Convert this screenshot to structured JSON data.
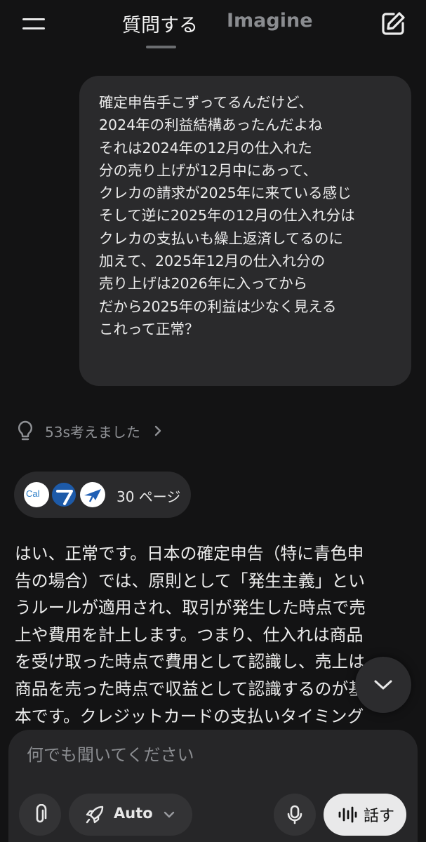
{
  "header": {
    "tabs": [
      {
        "label": "質問する",
        "active": true
      },
      {
        "label": "Imagine",
        "active": false
      }
    ],
    "icons": {
      "menu": "hamburger-menu-icon",
      "new_chat": "edit-square-icon"
    }
  },
  "conversation": {
    "user_message": {
      "lines": [
        "確定申告手こずってるんだけど、",
        "2024年の利益結構あったんだよね",
        "それは2024年の12月の仕入れた",
        "分の売り上げが12月中にあって、",
        "クレカの請求が2025年に来ている感じ",
        "そして逆に2025年の12月の仕入れ分は",
        "クレカの支払いも繰上返済してるのに",
        "加えて、2025年12月の仕入れ分の",
        "売り上げは2026年に入ってから",
        "だから2025年の利益は少なく見える",
        "これって正常？"
      ]
    },
    "thinking": {
      "label": "53s考えました",
      "icon": "lightbulb-icon"
    },
    "sources": {
      "label": "30 ページ",
      "icon_1_text": "Cal"
    },
    "assistant_message": {
      "lines": [
        "はい、正常です。日本の確定申告（特に青色申",
        "告の場合）では、原則として「発生主義」とい",
        "うルールが適用され、取引が発生した時点で売",
        "上や費用を計上します。つまり、仕入れは商品",
        "を受け取った時点で費用として認識し、売上は",
        "商品を売った時点で収益として認識するのが基",
        "本です。クレジットカードの支払いタイミング"
      ]
    }
  },
  "composer": {
    "placeholder": "何でも聞いてください",
    "model_label": "Auto",
    "voice_label": "話す"
  },
  "colors": {
    "background": "#131314",
    "bubble": "#2a2a2c",
    "composer": "#262628",
    "muted_text": "#8f9195",
    "voice_button": "#e9e9ea"
  }
}
